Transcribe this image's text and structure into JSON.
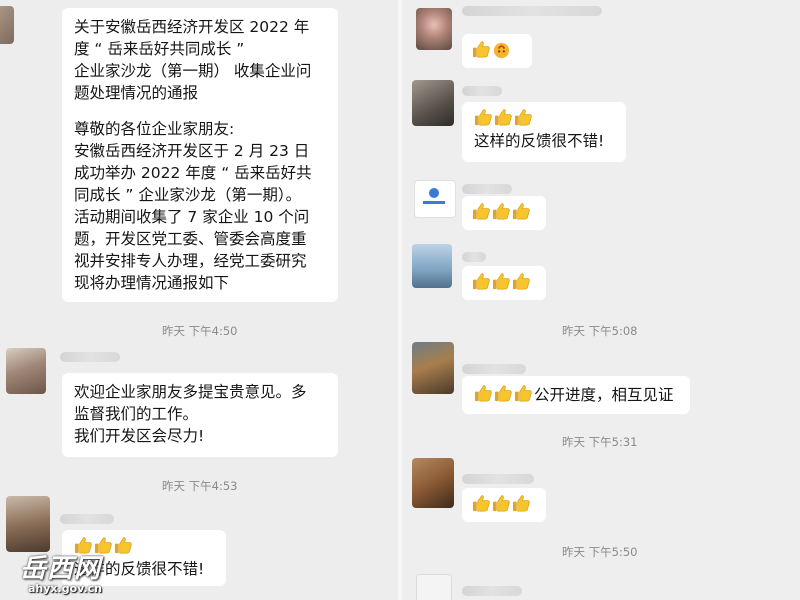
{
  "left_pane": {
    "announcement": {
      "lines": [
        "关于安徽岳西经济开发区 2022 年",
        "度 “ 岳来岳好共同成长 ”",
        "企业家沙龙（第一期） 收集企业问",
        "题处理情况的通报",
        "尊敬的各位企业家朋友:",
        " 安徽岳西经济开发区于 2 月 23 日",
        "成功举办 2022 年度 “ 岳来岳好共",
        "同成长 ” 企业家沙龙（第一期）。",
        "活动期间收集了 7 家企业 10 个问",
        "题，开发区党工委、管委会高度重",
        "视并安排专人办理，经党工委研究",
        "现将办理情况通报如下"
      ]
    },
    "time_1": "昨天 下午4:50",
    "message_2": {
      "lines": [
        "欢迎企业家朋友多提宝贵意见。多",
        "监督我们的工作。",
        "我们开发区会尽力!"
      ]
    },
    "time_2": "昨天 下午4:53",
    "message_3": {
      "text": "这样的反馈很不错!",
      "thumbs": 3
    }
  },
  "right_pane": {
    "message_1": {
      "thumbs": 2,
      "extra_emoji": "fire-emoji"
    },
    "message_2": {
      "thumbs": 3,
      "text": "这样的反馈很不错!"
    },
    "message_3": {
      "thumbs": 3
    },
    "message_4": {
      "thumbs": 3
    },
    "time_1": "昨天 下午5:08",
    "message_5": {
      "thumbs": 3,
      "text": "公开进度，相互见证"
    },
    "time_2": "昨天 下午5:31",
    "message_6": {
      "thumbs": 3
    },
    "time_3": "昨天 下午5:50"
  },
  "watermark": {
    "logo": "岳西网",
    "url": "ahyx.gov.cn"
  },
  "colors": {
    "chat_background": "#ededed",
    "bubble": "#ffffff",
    "timestamp": "#8a8a8a",
    "thumb_yellow": "#f7c52b"
  }
}
